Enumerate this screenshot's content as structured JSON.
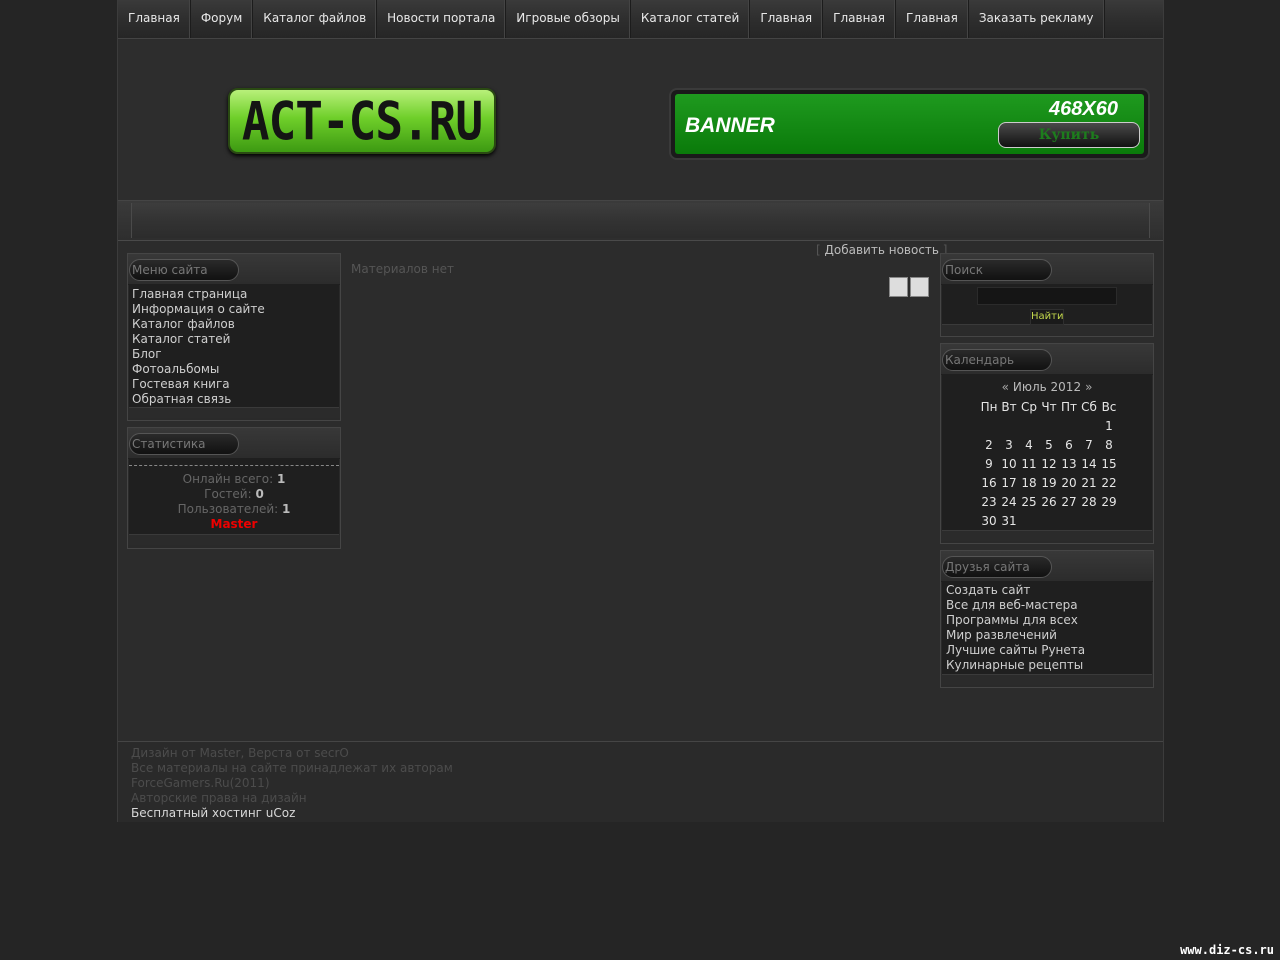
{
  "nav": [
    "Главная",
    "Форум",
    "Каталог файлов",
    "Новости портала",
    "Игровые обзоры",
    "Каталог статей",
    "Главная",
    "Главная",
    "Главная",
    "Заказать рекламу"
  ],
  "logo_text": "ACT-CS.RU",
  "banner": {
    "title": "BANNER",
    "size": "468X60",
    "button": "Купить"
  },
  "menu": {
    "title": "Меню сайта",
    "items": [
      "Главная страница",
      "Информация о сайте",
      "Каталог файлов",
      "Каталог статей",
      "Блог",
      "Фотоальбомы",
      "Гостевая книга",
      "Обратная связь"
    ]
  },
  "stats": {
    "title": "Статистика",
    "online_label": "Онлайн всего:",
    "online": "1",
    "guests_label": "Гостей:",
    "guests": "0",
    "users_label": "Пользователей:",
    "users": "1",
    "user": "Master"
  },
  "center": {
    "add_news": "Добавить новость",
    "no_materials": "Материалов нет"
  },
  "search": {
    "title": "Поиск",
    "button": "Найти"
  },
  "calendar": {
    "title": "Календарь",
    "prev": "«",
    "month": "Июль 2012",
    "next": "»",
    "weekdays": [
      "Пн",
      "Вт",
      "Ср",
      "Чт",
      "Пт",
      "Сб",
      "Вс"
    ],
    "weeks": [
      [
        "",
        "",
        "",
        "",
        "",
        "",
        "1"
      ],
      [
        "2",
        "3",
        "4",
        "5",
        "6",
        "7",
        "8"
      ],
      [
        "9",
        "10",
        "11",
        "12",
        "13",
        "14",
        "15"
      ],
      [
        "16",
        "17",
        "18",
        "19",
        "20",
        "21",
        "22"
      ],
      [
        "23",
        "24",
        "25",
        "26",
        "27",
        "28",
        "29"
      ],
      [
        "30",
        "31",
        "",
        "",
        "",
        "",
        ""
      ]
    ]
  },
  "friends": {
    "title": "Друзья сайта",
    "items": [
      "Создать сайт",
      "Все для веб-мастера",
      "Программы для всех",
      "Мир развлечений",
      "Лучшие сайты Рунета",
      "Кулинарные рецепты"
    ]
  },
  "footer": [
    "Дизайн от Master, Верста от secrO",
    "Все материалы на сайте принадлежат их авторам",
    "ForceGamers.Ru(2011)",
    "Авторские права на дизайн",
    "Бесплатный хостинг uCoz"
  ],
  "watermark": "www.diz-cs.ru"
}
